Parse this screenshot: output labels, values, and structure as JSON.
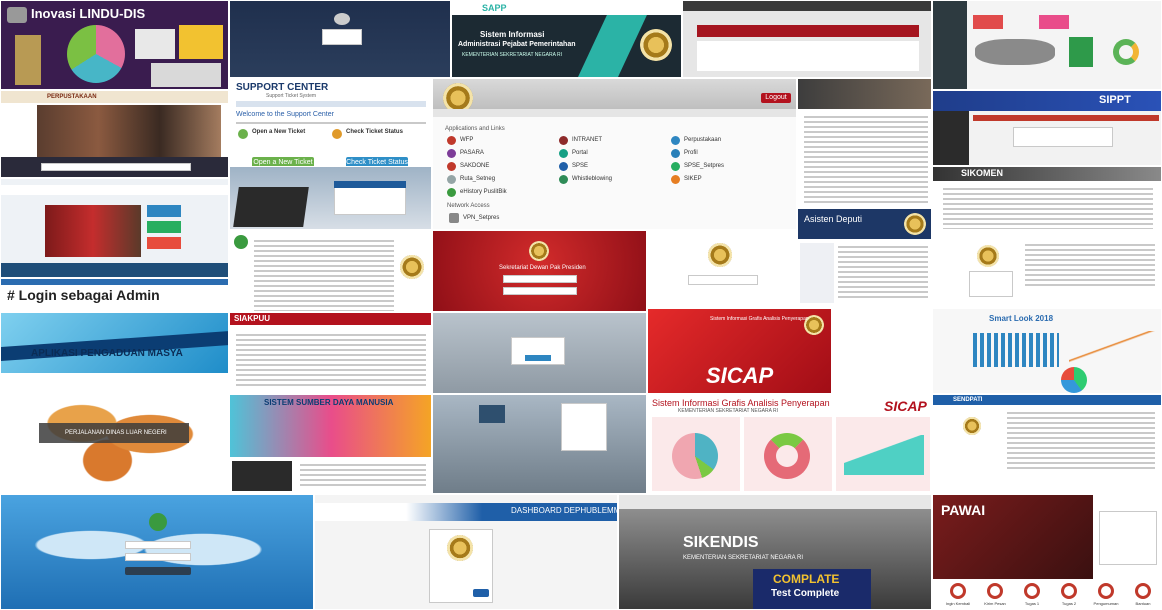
{
  "tiles": {
    "lindu": {
      "title": "Inovasi LINDU-DIS"
    },
    "nightlogin": {},
    "sapp": {
      "brand": "SAPP",
      "line1": "Sistem Informasi",
      "line2": "Administrasi Pejabat Pemerintahan",
      "line3": "KEMENTERIAN SEKRETARIAT NEGARA RI"
    },
    "news": {},
    "dashboard1": {},
    "library": {
      "header": "PERPUSTAKAAN"
    },
    "support": {
      "title": "SUPPORT CENTER",
      "subtitle": "Support Ticket System",
      "welcome": "Welcome to the Support Center",
      "open_title": "Open a New Ticket",
      "check_title": "Check Ticket Status",
      "open_btn": "Open a New Ticket",
      "check_btn": "Check Ticket Status"
    },
    "apps": {
      "section": "Applications and Links",
      "logout": "Logout",
      "network": "Network Access",
      "items": [
        "WFP",
        "INTRANET",
        "Perpustakaan",
        "PASARA",
        "Portal",
        "Profil",
        "SAKDONE",
        "SPSE",
        "SPSE_Setpres",
        "Ruta_Setneg",
        "Whistleblowing",
        "SIKEP",
        "eHistory PuslitBik"
      ],
      "vpn": "VPN_Setpres"
    },
    "slides": {},
    "nippt": {
      "title": "SIPPT"
    },
    "portal": {},
    "laptop": {},
    "asdep": {
      "title": "Asisten Deputi"
    },
    "sikomen": {
      "title": "SIKOMEN"
    },
    "login_admin": {
      "label": "# Login sebagai Admin"
    },
    "document": {},
    "redlogin": {
      "title": "Sekretariat Dewan Pak Presiden"
    },
    "foundation": {},
    "pengaduan": {
      "label": "APLIKASI PENGADUAN MASYA"
    },
    "siakpuu": {
      "title": "SIAKPUU"
    },
    "building1": {},
    "sicap": {
      "brand": "SICAP",
      "sub": "Sistem Informasi Grafis Analisis Penyerapan"
    },
    "smartlook": {
      "title": "Smart Look 2018"
    },
    "worldmap": {
      "label": "PERJALANAN DINAS LUAR NEGERI"
    },
    "sdm": {
      "title": "SISTEM SUMBER DAYA MANUSIA"
    },
    "building2": {},
    "grafis": {
      "title": "Sistem Informasi Grafis Analisis Penyerapan",
      "subtitle": "KEMENTERIAN SEKRETARIAT NEGARA RI",
      "brand": "SICAP"
    },
    "sendpati": {
      "title": "SENDPATI"
    },
    "bluelogin": {},
    "dephub": {
      "title": "DASHBOARD DEPHUBLEMMAS"
    },
    "sikendis": {
      "title": "SIKENDIS",
      "subtitle": "KEMENTERIAN SEKRETARIAT NEGARA RI",
      "badge1": "COMPLATE",
      "badge2": "Test Complete"
    },
    "pawai": {
      "title": "PAWAI",
      "icons": [
        "Ingin Kembali",
        "Kirim Pesan",
        "Tugas 1",
        "Tugas 2",
        "Pengumuman",
        "Bantuan"
      ]
    }
  },
  "colors": {
    "purple": "#3a1c4f",
    "navy": "#1f2f4d",
    "teal": "#2bb3a6",
    "red": "#b3121e",
    "green": "#3a9a3f",
    "gold": "#c9a227"
  }
}
